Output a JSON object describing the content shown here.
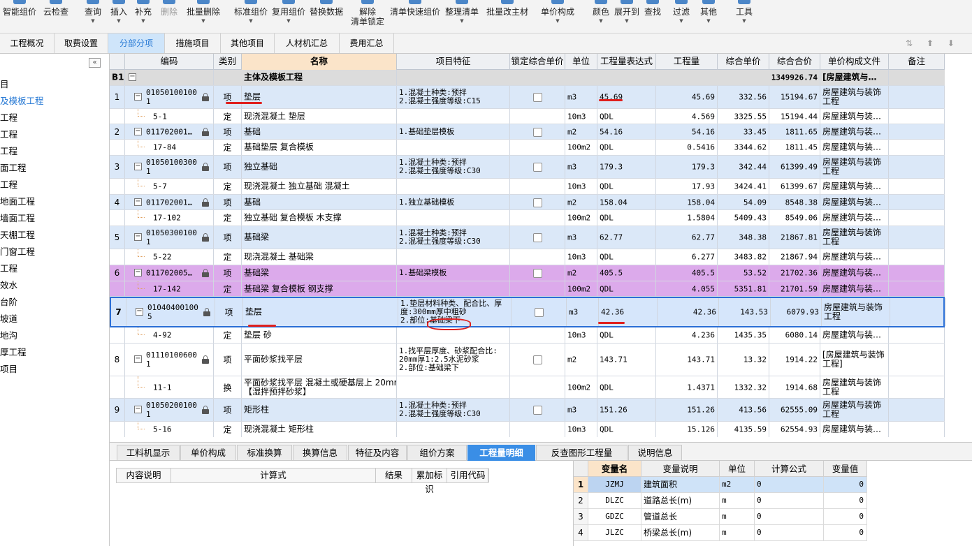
{
  "toolbar": {
    "buttons": [
      {
        "label": "智能组价",
        "dropdown": false
      },
      {
        "label": "云检查",
        "dropdown": false
      },
      {
        "label": "查询",
        "dropdown": true
      },
      {
        "label": "插入",
        "dropdown": true
      },
      {
        "label": "补充",
        "dropdown": true
      },
      {
        "label": "删除",
        "dropdown": false,
        "disabled": true
      },
      {
        "label": "批量删除",
        "dropdown": true
      },
      {
        "label": "标准组价",
        "dropdown": true
      },
      {
        "label": "复用组价",
        "dropdown": true
      },
      {
        "label": "替换数据",
        "dropdown": false
      },
      {
        "label": "解除",
        "label2": "清单锁定",
        "dropdown": false
      },
      {
        "label": "清单快速组价",
        "dropdown": false
      },
      {
        "label": "整理清单",
        "dropdown": true
      },
      {
        "label": "批量改主材",
        "dropdown": false
      },
      {
        "label": "单价构成",
        "dropdown": true
      },
      {
        "label": "颜色",
        "dropdown": true
      },
      {
        "label": "展开到",
        "dropdown": true
      },
      {
        "label": "查找",
        "dropdown": false
      },
      {
        "label": "过滤",
        "dropdown": true
      },
      {
        "label": "其他",
        "dropdown": true
      },
      {
        "label": "工具",
        "dropdown": true
      }
    ]
  },
  "main_tabs": [
    "工程概况",
    "取费设置",
    "分部分项",
    "措施项目",
    "其他项目",
    "人材机汇总",
    "费用汇总"
  ],
  "main_tab_active": "分部分项",
  "left_tree": [
    "目",
    "及模板工程",
    "工程",
    "工程",
    "工程",
    "面工程",
    "工程",
    "地面工程",
    "墙面工程",
    "天棚工程",
    "门窗工程",
    "工程",
    "效水",
    "台阶",
    "坡道",
    "地沟",
    "厚工程",
    "项目"
  ],
  "left_tree_selected": 1,
  "grid": {
    "headers": [
      "编码",
      "类别",
      "名称",
      "项目特征",
      "锁定综合单价",
      "单位",
      "工程量表达式",
      "工程量",
      "综合单价",
      "综合合价",
      "单价构成文件",
      "备注"
    ],
    "header_name_highlight": "名称",
    "section": {
      "seq": "B1",
      "name": "主体及模板工程",
      "total": "1349926.74",
      "file": "[房屋建筑与…"
    },
    "rows": [
      {
        "style": "q",
        "seq": "1",
        "code": "010501001001",
        "code_l1": "01050100100",
        "code_l2": "1",
        "cat": "项",
        "name": "垫层",
        "feat": "1.混凝土种类:预拌\n2.混凝土强度等级:C15",
        "unit": "m3",
        "expr": "45.69",
        "qty": "45.69",
        "price": "332.56",
        "total": "15194.67",
        "file": "房屋建筑与装饰\n工程",
        "h": 33
      },
      {
        "style": "d",
        "seq": "",
        "code": "5-1",
        "cat": "定",
        "name": "现浇混凝土 垫层",
        "feat": "",
        "unit": "10m3",
        "expr": "QDL",
        "qty": "4.569",
        "price": "3325.55",
        "total": "15194.44",
        "file": "房屋建筑与装…",
        "h": 22
      },
      {
        "style": "q",
        "seq": "2",
        "code": "011702001…",
        "cat": "项",
        "name": "基础",
        "feat": "1.基础垫层模板",
        "unit": "m2",
        "expr": "54.16",
        "qty": "54.16",
        "price": "33.45",
        "total": "1811.65",
        "file": "房屋建筑与装…",
        "h": 22
      },
      {
        "style": "d",
        "seq": "",
        "code": "17-84",
        "cat": "定",
        "name": "基础垫层 复合模板",
        "feat": "",
        "unit": "100m2",
        "expr": "QDL",
        "qty": "0.5416",
        "price": "3344.62",
        "total": "1811.45",
        "file": "房屋建筑与装…",
        "h": 23
      },
      {
        "style": "q",
        "seq": "3",
        "code_l1": "01050100300",
        "code_l2": "1",
        "cat": "项",
        "name": "独立基础",
        "feat": "1.混凝土种类:预拌\n2.混凝土强度等级:C30",
        "unit": "m3",
        "expr": "179.3",
        "qty": "179.3",
        "price": "342.44",
        "total": "61399.49",
        "file": "房屋建筑与装饰\n工程",
        "h": 33
      },
      {
        "style": "d",
        "seq": "",
        "code": "5-7",
        "cat": "定",
        "name": "现浇混凝土 独立基础 混凝土",
        "feat": "",
        "unit": "10m3",
        "expr": "QDL",
        "qty": "17.93",
        "price": "3424.41",
        "total": "61399.67",
        "file": "房屋建筑与装…",
        "h": 23
      },
      {
        "style": "q",
        "seq": "4",
        "code": "011702001…",
        "cat": "项",
        "name": "基础",
        "feat": "1.独立基础模板",
        "unit": "m2",
        "expr": "158.04",
        "qty": "158.04",
        "price": "54.09",
        "total": "8548.38",
        "file": "房屋建筑与装…",
        "h": 22
      },
      {
        "style": "d",
        "seq": "",
        "code": "17-102",
        "cat": "定",
        "name": "独立基础 复合模板 木支撑",
        "feat": "",
        "unit": "100m2",
        "expr": "QDL",
        "qty": "1.5804",
        "price": "5409.43",
        "total": "8549.06",
        "file": "房屋建筑与装…",
        "h": 23
      },
      {
        "style": "q",
        "seq": "5",
        "code_l1": "01050300100",
        "code_l2": "1",
        "cat": "项",
        "name": "基础梁",
        "feat": "1.混凝土种类:预拌\n2.混凝土强度等级:C30",
        "unit": "m3",
        "expr": "62.77",
        "qty": "62.77",
        "price": "348.38",
        "total": "21867.81",
        "file": "房屋建筑与装饰\n工程",
        "h": 33
      },
      {
        "style": "d",
        "seq": "",
        "code": "5-22",
        "cat": "定",
        "name": "现浇混凝土 基础梁",
        "feat": "",
        "unit": "10m3",
        "expr": "QDL",
        "qty": "6.277",
        "price": "3483.82",
        "total": "21867.94",
        "file": "房屋建筑与装…",
        "h": 23
      },
      {
        "style": "p",
        "seq": "6",
        "code": "011702005…",
        "cat": "项",
        "name": "基础梁",
        "feat": "1.基础梁模板",
        "unit": "m2",
        "expr": "405.5",
        "qty": "405.5",
        "price": "53.52",
        "total": "21702.36",
        "file": "房屋建筑与装…",
        "h": 23
      },
      {
        "style": "p",
        "seq": "",
        "code": "17-142",
        "cat": "定",
        "name": "基础梁 复合模板 钢支撑",
        "feat": "",
        "unit": "100m2",
        "expr": "QDL",
        "qty": "4.055",
        "price": "5351.81",
        "total": "21701.59",
        "file": "房屋建筑与装…",
        "h": 22
      },
      {
        "style": "s",
        "seq": "7",
        "code_l1": "01040400100",
        "code_l2": "5",
        "cat": "项",
        "name": "垫层",
        "feat": "1.垫层材料种类、配合比、厚\n度:300mm厚中粗砂\n2.部位:基础梁下",
        "unit": "m3",
        "expr": "42.36",
        "qty": "42.36",
        "price": "143.53",
        "total": "6079.93",
        "file": "房屋建筑与装饰\n工程",
        "h": 44
      },
      {
        "style": "d",
        "seq": "",
        "code": "4-92",
        "cat": "定",
        "name": "垫层 砂",
        "feat": "",
        "unit": "10m3",
        "expr": "QDL",
        "qty": "4.236",
        "price": "1435.35",
        "total": "6080.14",
        "file": "房屋建筑与装…",
        "h": 23
      },
      {
        "style": "d",
        "seq": "8",
        "code_l1": "01110100600",
        "code_l2": "1",
        "cat": "项",
        "name": "平面砂浆找平层",
        "feat": "1.找平层厚度、砂浆配合比:\n20mm厚1:2.5水泥砂浆\n2.部位:基础梁下",
        "unit": "m2",
        "expr": "143.71",
        "qty": "143.71",
        "price": "13.32",
        "total": "1914.22",
        "file": "[房屋建筑与装饰\n工程]",
        "h": 47
      },
      {
        "style": "d",
        "seq": "",
        "code": "11-1",
        "cat": "换",
        "name": "平面砂浆找平层 混凝土或硬基层上 20mm\n【湿拌预拌砂浆】",
        "feat": "",
        "unit": "100m2",
        "expr": "QDL",
        "qty": "1.4371",
        "price": "1332.32",
        "total": "1914.68",
        "file": "房屋建筑与装饰\n工程",
        "h": 32
      },
      {
        "style": "q",
        "seq": "9",
        "code_l1": "01050200100",
        "code_l2": "1",
        "cat": "项",
        "name": "矩形柱",
        "feat": "1.混凝土种类:预拌\n2.混凝土强度等级:C30",
        "unit": "m3",
        "expr": "151.26",
        "qty": "151.26",
        "price": "413.56",
        "total": "62555.09",
        "file": "房屋建筑与装饰\n工程",
        "h": 33
      },
      {
        "style": "d",
        "seq": "",
        "code": "5-16",
        "cat": "定",
        "name": "现浇混凝土 矩形柱",
        "feat": "",
        "unit": "10m3",
        "expr": "QDL",
        "qty": "15.126",
        "price": "4135.59",
        "total": "62554.93",
        "file": "房屋建筑与装…",
        "h": 23
      }
    ]
  },
  "bottom_tabs": [
    "工料机显示",
    "单价构成",
    "标准换算",
    "换算信息",
    "特征及内容",
    "组价方案",
    "工程量明细",
    "反查图形工程量",
    "说明信息"
  ],
  "bottom_tab_active": "工程量明细",
  "calc_headers": [
    "内容说明",
    "计算式",
    "结果",
    "累加标识",
    "引用代码"
  ],
  "var_headers": [
    "变量名",
    "变量说明",
    "单位",
    "计算公式",
    "变量值"
  ],
  "var_rows": [
    {
      "seq": "1",
      "name": "JZMJ",
      "desc": "建筑面积",
      "unit": "m2",
      "formula": "0",
      "value": "0"
    },
    {
      "seq": "2",
      "name": "DLZC",
      "desc": "道路总长(m)",
      "unit": "m",
      "formula": "0",
      "value": "0"
    },
    {
      "seq": "3",
      "name": "GDZC",
      "desc": "管道总长",
      "unit": "m",
      "formula": "0",
      "value": "0"
    },
    {
      "seq": "4",
      "name": "JLZC",
      "desc": "桥梁总长(m)",
      "unit": "m",
      "formula": "0",
      "value": "0"
    }
  ],
  "colors": {
    "accent": "#3a8ee6",
    "quota_row": "#dbe8f8",
    "highlight_row": "#dcaaeb",
    "selected_border": "#2b6fd6",
    "annotation": "#e0201e"
  }
}
